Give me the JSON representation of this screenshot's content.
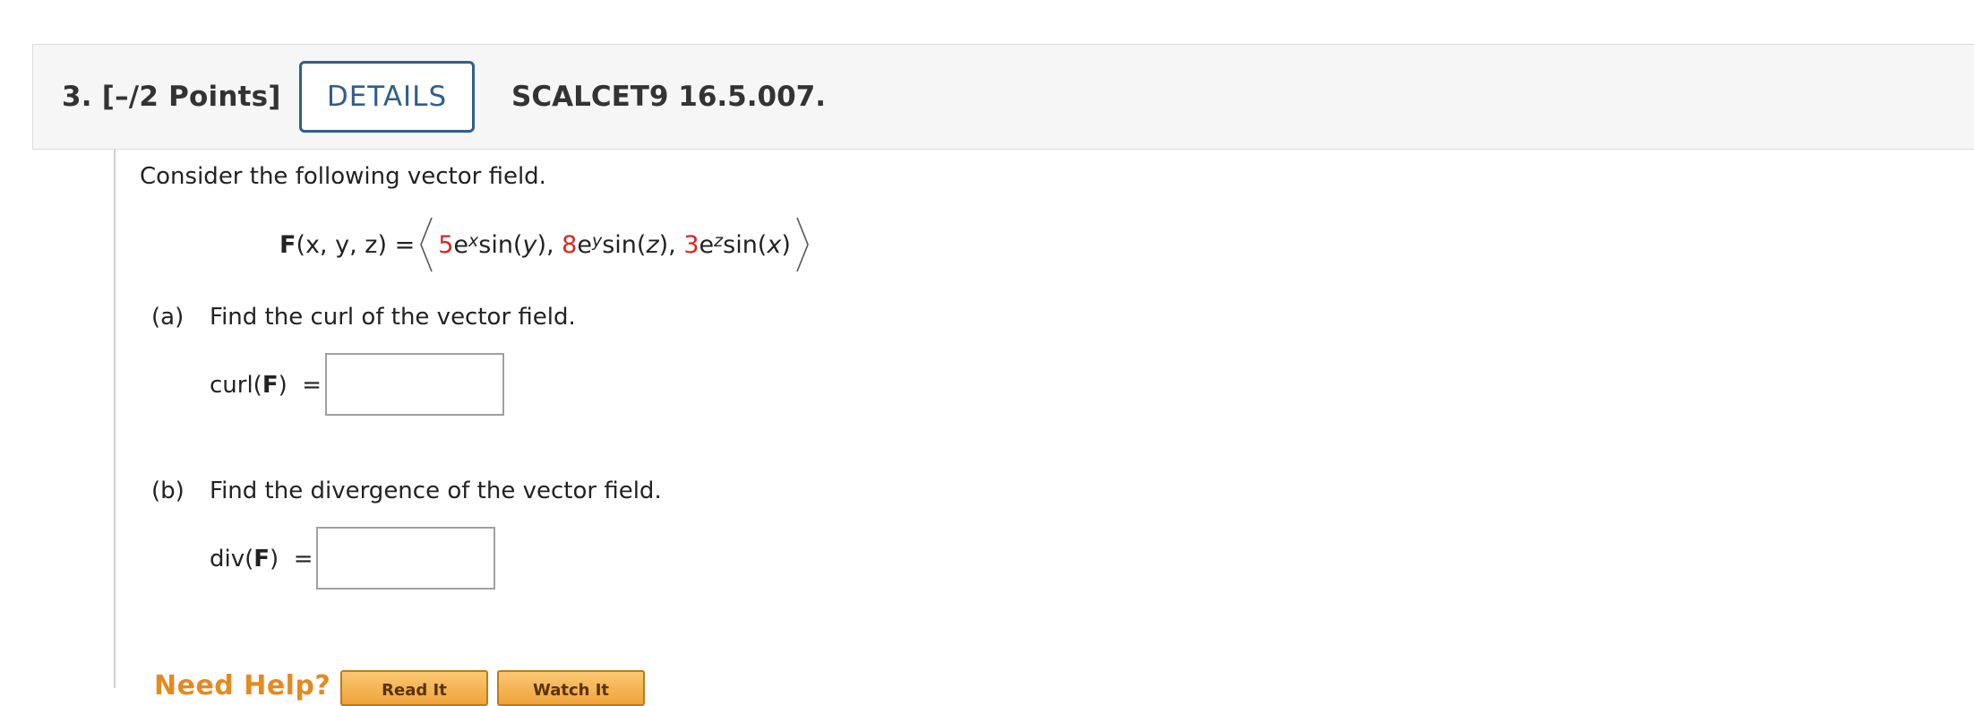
{
  "question": {
    "number_points": "3.  [–/2 Points]",
    "details_button": "DETAILS",
    "reference": "SCALCET9 16.5.007."
  },
  "prompt": "Consider the following vector field.",
  "formula": {
    "lhs": "(x, y, z) =",
    "lhs_bold": "F",
    "c1": "5",
    "e1": "e",
    "exp1": "x",
    "t1": " sin(",
    "v1": "y",
    "t1b": "), ",
    "c2": "8",
    "e2": "e",
    "exp2": "y",
    "t2": " sin(",
    "v2": "z",
    "t2b": "), ",
    "c3": "3",
    "e3": "e",
    "exp3": "z",
    "t3": " sin(",
    "v3": "x",
    "t3b": ")"
  },
  "part_a": {
    "label": "(a)",
    "text": "Find the curl of the vector field.",
    "answer_prefix": "curl(",
    "answer_bold": "F",
    "answer_suffix": ")  =",
    "value": ""
  },
  "part_b": {
    "label": "(b)",
    "text": "Find the divergence of the vector field.",
    "answer_prefix": "div(",
    "answer_bold": "F",
    "answer_suffix": ")  =",
    "value": ""
  },
  "help": {
    "label": "Need Help?",
    "read_it": "Read It",
    "watch_it": "Watch It"
  },
  "colors": {
    "accent_blue": "#2e5f8e",
    "coefficient_red": "#d9261c",
    "help_orange": "#e58a1f"
  }
}
